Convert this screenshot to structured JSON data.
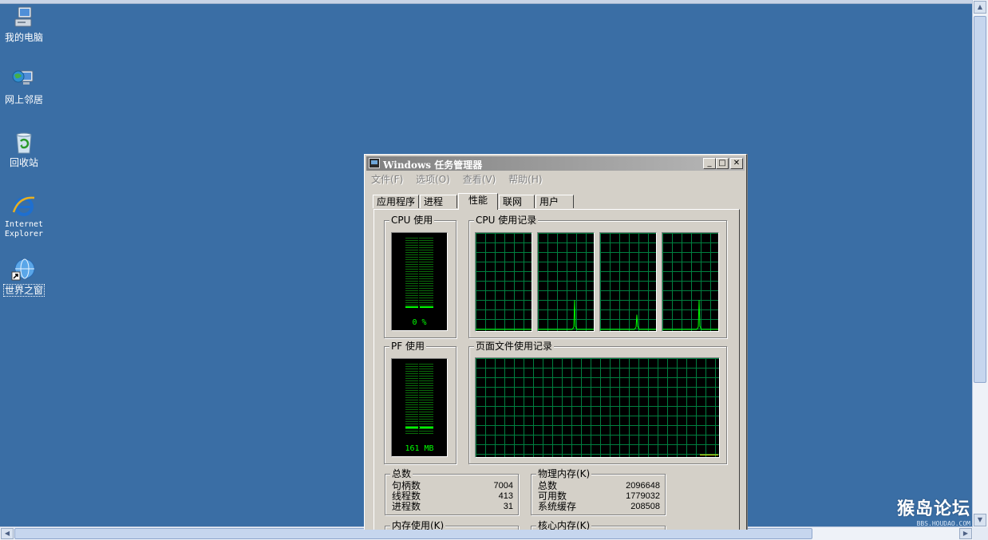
{
  "desktop": {
    "icons": [
      {
        "label": "我的电脑",
        "icon": "computer-icon"
      },
      {
        "label": "网上邻居",
        "icon": "network-icon"
      },
      {
        "label": "回收站",
        "icon": "recycle-bin-icon"
      },
      {
        "label": "Internet\nExplorer",
        "line1": "Internet",
        "line2": "Explorer",
        "icon": "internet-explorer-icon"
      },
      {
        "label": "世界之窗",
        "icon": "globe-shortcut-icon"
      }
    ],
    "watermark": {
      "big": "猴岛论坛",
      "small": "BBS.HOUDAO.COM"
    }
  },
  "window": {
    "title": "Windows 任务管理器",
    "minimize": "_",
    "maximize": "□",
    "close": "✕",
    "menu": [
      "文件(F)",
      "选项(O)",
      "查看(V)",
      "帮助(H)"
    ],
    "tabs": [
      "应用程序",
      "进程",
      "性能",
      "联网",
      "用户"
    ],
    "active_tab": "性能",
    "cpu_usage": {
      "label": "CPU 使用",
      "value": "0 %",
      "level": 0
    },
    "cpu_history": {
      "label": "CPU 使用记录",
      "cores": 4,
      "spikes": [
        0,
        0.3,
        0.15,
        0.3
      ]
    },
    "pf_usage": {
      "label": "PF 使用",
      "value": "161 MB",
      "level": 0.08
    },
    "pf_history": {
      "label": "页面文件使用记录",
      "level": 0.08
    },
    "totals": {
      "label": "总数",
      "handles_label": "句柄数",
      "handles": "7004",
      "threads_label": "线程数",
      "threads": "413",
      "processes_label": "进程数",
      "processes": "31"
    },
    "physical_memory": {
      "label": "物理内存(K)",
      "total_label": "总数",
      "total": "2096648",
      "available_label": "可用数",
      "available": "1779032",
      "cache_label": "系统缓存",
      "cache": "208508"
    },
    "commit_charge": {
      "label": "内存使用(K)"
    },
    "kernel_memory": {
      "label": "核心内存(K)"
    }
  }
}
